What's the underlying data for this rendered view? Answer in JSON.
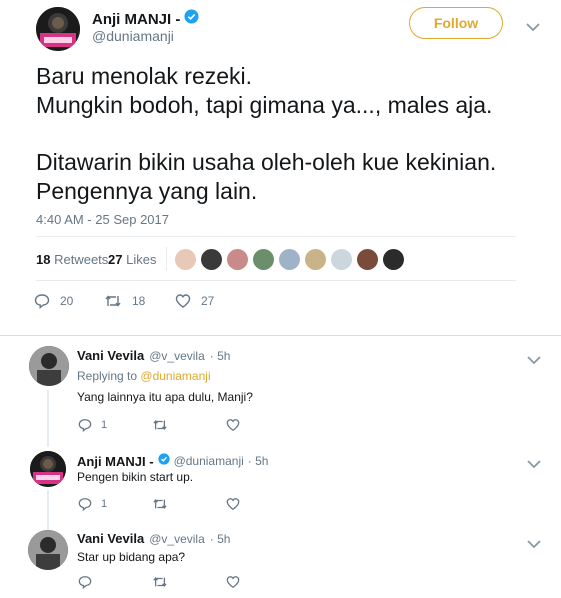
{
  "tweet": {
    "author_name": "Anji MANJI -",
    "author_handle": "@duniamanji",
    "follow_label": "Follow",
    "lines": [
      "Baru menolak rezeki.",
      "Mungkin bodoh, tapi gimana ya..., males aja.",
      "Ditawarin bikin usaha oleh-oleh kue kekinian.",
      "Pengennya yang lain."
    ],
    "timestamp": "4:40 AM - 25 Sep 2017",
    "retweets_count": "18",
    "retweets_label": "Retweets",
    "likes_count": "27",
    "likes_label": "Likes",
    "actions": {
      "replies": "20",
      "retweets": "18",
      "likes": "27"
    }
  },
  "replies": [
    {
      "name": "Vani Vevila",
      "handle": "@v_vevila",
      "time": "· 5h",
      "replying_prefix": "Replying to",
      "replying_to": "@duniamanji",
      "text": "Yang lainnya itu apa dulu, Manji?",
      "reply_count": "1"
    },
    {
      "name": "Anji MANJI -",
      "handle": "@duniamanji",
      "time": "· 5h",
      "text": "Pengen bikin start up.",
      "reply_count": "1"
    },
    {
      "name": "Vani Vevila",
      "handle": "@v_vevila",
      "time": "· 5h",
      "text": "Star up bidang apa?"
    }
  ],
  "colors": {
    "accent": "#e0a82e",
    "verified": "#1da1f2",
    "muted": "#657786",
    "divider": "#e6ecf0"
  },
  "icons": [
    "verified-badge-icon",
    "chevron-down-icon",
    "reply-icon",
    "retweet-icon",
    "like-icon"
  ]
}
